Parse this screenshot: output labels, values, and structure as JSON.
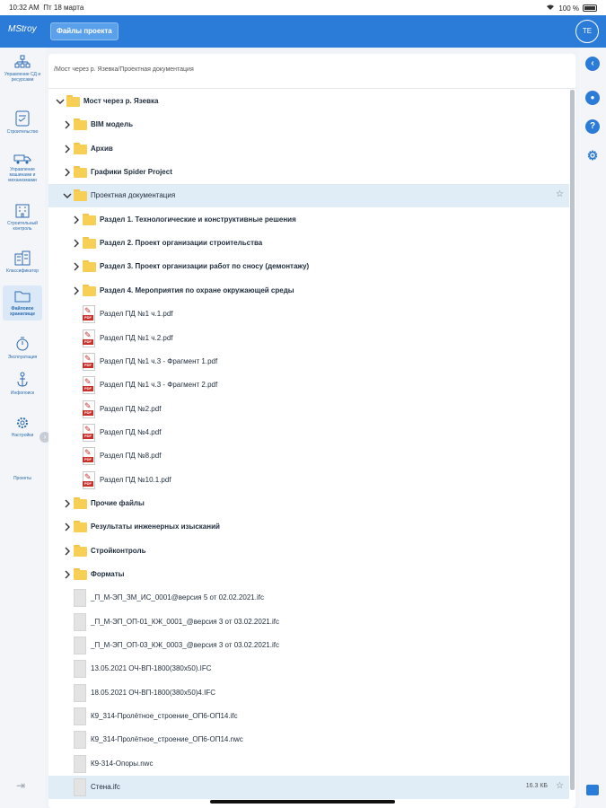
{
  "status_bar": {
    "time": "10:32 AM",
    "date": "Пт 18 марта",
    "battery": "100 %"
  },
  "header": {
    "brand": "MStroy",
    "tab": "Файлы проекта",
    "avatar": "TE"
  },
  "sidebar": {
    "items": [
      {
        "label": "Управление СД и ресурсами",
        "icon": "org-chart-icon"
      },
      {
        "label": "Строительство",
        "icon": "checklist-icon"
      },
      {
        "label": "Управление машинами и механизмами",
        "icon": "truck-icon"
      },
      {
        "label": "Строительный контроль",
        "icon": "building-icon"
      },
      {
        "label": "Классификатор",
        "icon": "buildings-icon"
      },
      {
        "label": "Файловое хранилище",
        "icon": "folder-icon"
      },
      {
        "label": "Эксплуатация",
        "icon": "stopwatch-icon"
      },
      {
        "label": "Инфопоиск",
        "icon": "anchor-icon"
      },
      {
        "label": "Настройки",
        "icon": "gear-icon"
      },
      {
        "label": "Проекты",
        "icon": ""
      }
    ]
  },
  "breadcrumb": "/Мост через р. Язевка/Проектная документация",
  "tree": [
    {
      "type": "folder",
      "level": 0,
      "expanded": true,
      "label": "Мост через р. Язевка",
      "bold": true
    },
    {
      "type": "folder",
      "level": 1,
      "expanded": false,
      "label": "BIM модель",
      "bold": true
    },
    {
      "type": "folder",
      "level": 1,
      "expanded": false,
      "label": "Архив",
      "bold": true
    },
    {
      "type": "folder",
      "level": 1,
      "expanded": false,
      "label": "Графики Spider Project",
      "bold": true
    },
    {
      "type": "folder",
      "level": 1,
      "expanded": true,
      "label": "Проектная документация",
      "bold": false,
      "selected": true,
      "star": true
    },
    {
      "type": "folder",
      "level": 2,
      "expanded": false,
      "label": "Раздел 1. Технологические и конструктивные решения",
      "bold": true
    },
    {
      "type": "folder",
      "level": 2,
      "expanded": false,
      "label": "Раздел 2. Проект организации строительства",
      "bold": true
    },
    {
      "type": "folder",
      "level": 2,
      "expanded": false,
      "label": "Раздел 3. Проект организации работ по сносу (демонтажу)",
      "bold": true
    },
    {
      "type": "folder",
      "level": 2,
      "expanded": false,
      "label": "Раздел 4. Мероприятия по охране окружающей среды",
      "bold": true
    },
    {
      "type": "pdf",
      "level": 2,
      "label": "Раздел ПД №1 ч.1.pdf"
    },
    {
      "type": "pdf",
      "level": 2,
      "label": "Раздел ПД №1 ч.2.pdf"
    },
    {
      "type": "pdf",
      "level": 2,
      "label": "Раздел ПД №1 ч.3 - Фрагмент 1.pdf"
    },
    {
      "type": "pdf",
      "level": 2,
      "label": "Раздел ПД №1 ч.3 - Фрагмент 2.pdf"
    },
    {
      "type": "pdf",
      "level": 2,
      "label": "Раздел ПД №2.pdf"
    },
    {
      "type": "pdf",
      "level": 2,
      "label": "Раздел ПД №4.pdf"
    },
    {
      "type": "pdf",
      "level": 2,
      "label": "Раздел ПД №8.pdf"
    },
    {
      "type": "pdf",
      "level": 2,
      "label": "Раздел ПД №10.1.pdf"
    },
    {
      "type": "folder",
      "level": 1,
      "expanded": false,
      "label": "Прочие файлы",
      "bold": true
    },
    {
      "type": "folder",
      "level": 1,
      "expanded": false,
      "label": "Результаты инженерных изысканий",
      "bold": true
    },
    {
      "type": "folder",
      "level": 1,
      "expanded": false,
      "label": "Стройконтроль",
      "bold": true
    },
    {
      "type": "folder",
      "level": 1,
      "expanded": false,
      "label": "Форматы",
      "bold": true
    },
    {
      "type": "file",
      "level": 1,
      "label": "_П_М-ЭП_ЗМ_ИС_0001@версия 5 от 02.02.2021.ifc"
    },
    {
      "type": "file",
      "level": 1,
      "label": "_П_М-ЭП_ОП-01_КЖ_0001_@версия 3 от 03.02.2021.ifc"
    },
    {
      "type": "file",
      "level": 1,
      "label": "_П_М-ЭП_ОП-03_КЖ_0003_@версия 3 от 03.02.2021.ifc"
    },
    {
      "type": "file",
      "level": 1,
      "label": "13.05.2021 ОЧ-ВП-1800(380х50).IFC"
    },
    {
      "type": "file",
      "level": 1,
      "label": "18.05.2021 ОЧ-ВП-1800(380х50)4.IFC"
    },
    {
      "type": "file",
      "level": 1,
      "label": "К9_314-Пролётное_строение_ОП6-ОП14.ifc"
    },
    {
      "type": "file",
      "level": 1,
      "label": "К9_314-Пролётное_строение_ОП6-ОП14.nwc"
    },
    {
      "type": "file",
      "level": 1,
      "label": "К9-314-Опоры.nwc"
    },
    {
      "type": "file",
      "level": 1,
      "label": "Стена.ifc",
      "size": "16.3 КБ",
      "selected": true,
      "star": true
    }
  ]
}
